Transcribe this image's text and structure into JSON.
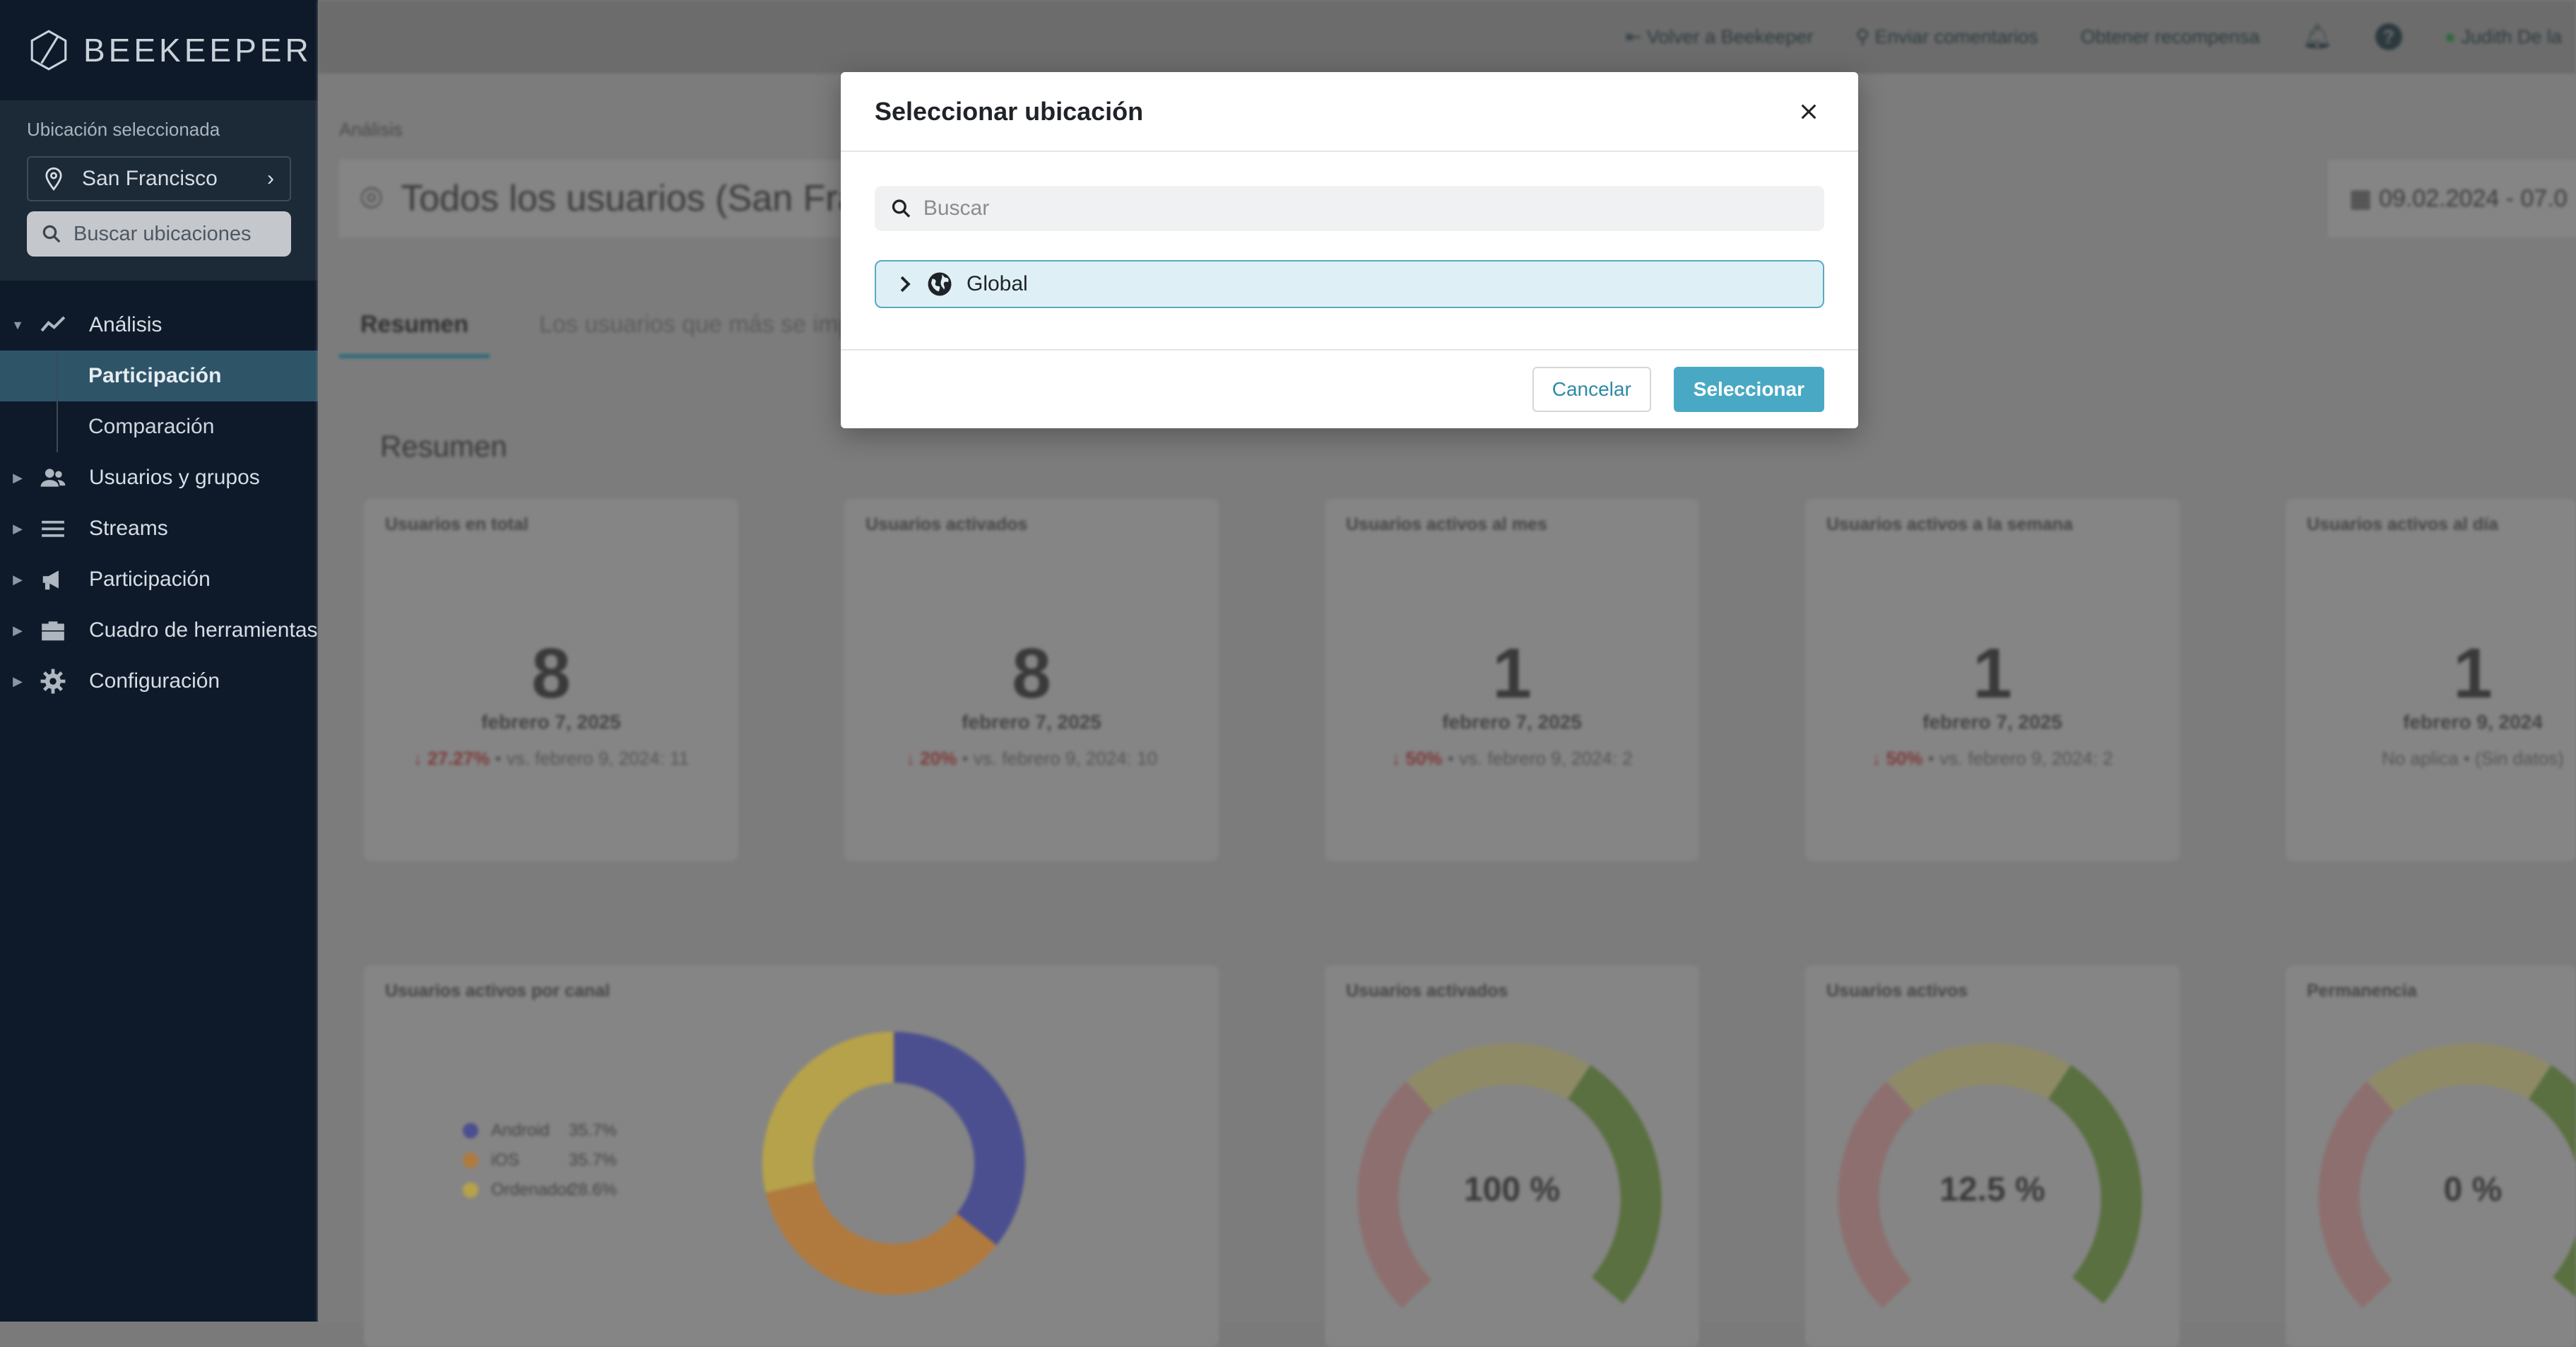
{
  "app": {
    "brand": "BEEKEEPER"
  },
  "sidebar": {
    "location_label": "Ubicación seleccionada",
    "location_value": "San Francisco",
    "search_placeholder": "Buscar ubicaciones",
    "nav": [
      {
        "label": "Análisis",
        "icon": "chart-line-icon",
        "expanded": true
      },
      {
        "label": "Participación",
        "active": true
      },
      {
        "label": "Comparación"
      },
      {
        "label": "Usuarios y grupos",
        "icon": "users-icon"
      },
      {
        "label": "Streams",
        "icon": "menu-icon"
      },
      {
        "label": "Participación",
        "icon": "megaphone-icon"
      },
      {
        "label": "Cuadro de herramientas",
        "icon": "toolbox-icon"
      },
      {
        "label": "Configuración",
        "icon": "gear-icon"
      }
    ]
  },
  "topbar": {
    "back": "Volver a Beekeeper",
    "feedback": "Enviar comentarios",
    "rewards": "Obtener recompensa",
    "user": "Judith De la"
  },
  "main": {
    "breadcrumb": "Análisis",
    "title": "Todos los usuarios (San Fran",
    "date_range": "09.02.2024 - 07.0",
    "tabs": [
      "Resumen",
      "Los usuarios que más se imp"
    ],
    "section_title": "Resumen",
    "stats": [
      {
        "title": "Usuarios en total",
        "value": "8",
        "date": "febrero 7, 2025",
        "change": "27.27%",
        "compare": "vs. febrero 9, 2024: 11"
      },
      {
        "title": "Usuarios activados",
        "value": "8",
        "date": "febrero 7, 2025",
        "change": "20%",
        "compare": "vs. febrero 9, 2024: 10"
      },
      {
        "title": "Usuarios activos al mes",
        "value": "1",
        "date": "febrero 7, 2025",
        "change": "50%",
        "compare": "vs. febrero 9, 2024: 2"
      },
      {
        "title": "Usuarios activos a la semana",
        "value": "1",
        "date": "febrero 7, 2025",
        "change": "50%",
        "compare": "vs. febrero 9, 2024: 2"
      },
      {
        "title": "Usuarios activos al día",
        "value": "1",
        "date": "febrero 9, 2024",
        "change": "",
        "compare": "No aplica • (Sin datos)"
      }
    ],
    "channel_card": {
      "title": "Usuarios activos por canal",
      "legend": [
        {
          "label": "Android",
          "pct": "35.7%",
          "color": "#4b4f8f"
        },
        {
          "label": "iOS",
          "pct": "35.7%",
          "color": "#b07a3e"
        },
        {
          "label": "Ordenador",
          "pct": "28.6%",
          "color": "#b6a24a"
        }
      ]
    },
    "gauges": [
      {
        "title": "Usuarios activados",
        "value": "100 %"
      },
      {
        "title": "Usuarios activos",
        "value": "12.5 %"
      },
      {
        "title": "Permanencia",
        "value": "0 %"
      }
    ]
  },
  "chart_data": {
    "type": "pie",
    "title": "Usuarios activos por canal",
    "categories": [
      "Android",
      "iOS",
      "Ordenador"
    ],
    "values": [
      35.7,
      35.7,
      28.6
    ]
  },
  "modal": {
    "title": "Seleccionar ubicación",
    "search_placeholder": "Buscar",
    "tree": [
      {
        "label": "Global",
        "icon": "globe-icon"
      }
    ],
    "cancel": "Cancelar",
    "select": "Seleccionar"
  }
}
